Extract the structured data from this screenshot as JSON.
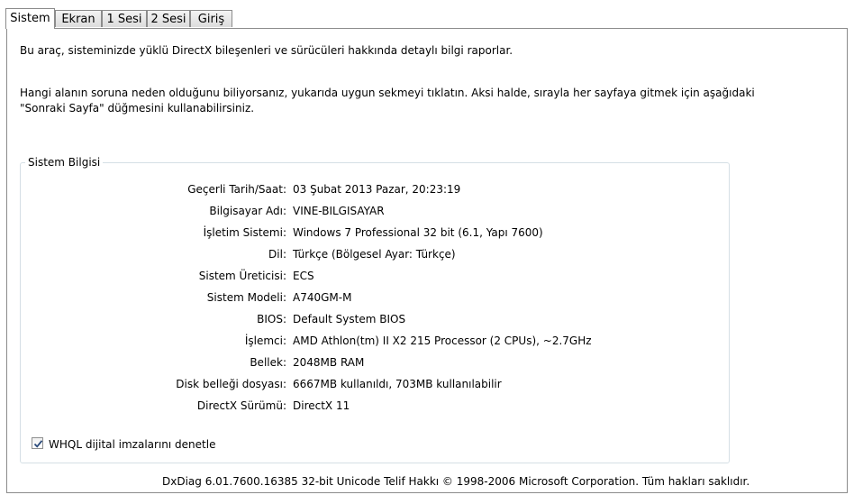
{
  "tabs": [
    {
      "label": "Sistem",
      "active": true
    },
    {
      "label": "Ekran",
      "active": false
    },
    {
      "label": "1 Sesi",
      "active": false
    },
    {
      "label": "2 Sesi",
      "active": false
    },
    {
      "label": "Giriş",
      "active": false
    }
  ],
  "intro": {
    "line1": "Bu araç, sisteminizde yüklü DirectX bileşenleri ve sürücüleri hakkında detaylı bilgi raporlar.",
    "line2": "Hangi alanın soruna neden olduğunu biliyorsanız, yukarıda uygun sekmeyi tıklatın.  Aksi halde, sırayla her sayfaya gitmek için aşağıdaki",
    "line3": "\"Sonraki Sayfa\" düğmesini kullanabilirsiniz."
  },
  "system_info": {
    "title": "Sistem Bilgisi",
    "rows": [
      {
        "label": "Geçerli Tarih/Saat:",
        "value": "03 Şubat 2013 Pazar, 20:23:19"
      },
      {
        "label": "Bilgisayar Adı:",
        "value": "VINE-BILGISAYAR"
      },
      {
        "label": "İşletim Sistemi:",
        "value": "Windows 7 Professional 32 bit (6.1, Yapı 7600)"
      },
      {
        "label": "Dil:",
        "value": "Türkçe (Bölgesel Ayar: Türkçe)"
      },
      {
        "label": "Sistem Üreticisi:",
        "value": "ECS"
      },
      {
        "label": "Sistem Modeli:",
        "value": "A740GM-M"
      },
      {
        "label": "BIOS:",
        "value": "Default System BIOS"
      },
      {
        "label": "İşlemci:",
        "value": "AMD Athlon(tm) II X2 215 Processor (2 CPUs), ~2.7GHz"
      },
      {
        "label": "Bellek:",
        "value": "2048MB RAM"
      },
      {
        "label": "Disk belleği dosyası:",
        "value": "6667MB kullanıldı, 703MB kullanılabilir"
      },
      {
        "label": "DirectX Sürümü:",
        "value": "DirectX 11"
      }
    ]
  },
  "whql": {
    "label": "WHQL dijital imzalarını denetle",
    "checked": true
  },
  "footer": "DxDiag 6.01.7600.16385 32-bit Unicode  Telif Hakkı © 1998-2006 Microsoft Corporation.  Tüm hakları saklıdır."
}
